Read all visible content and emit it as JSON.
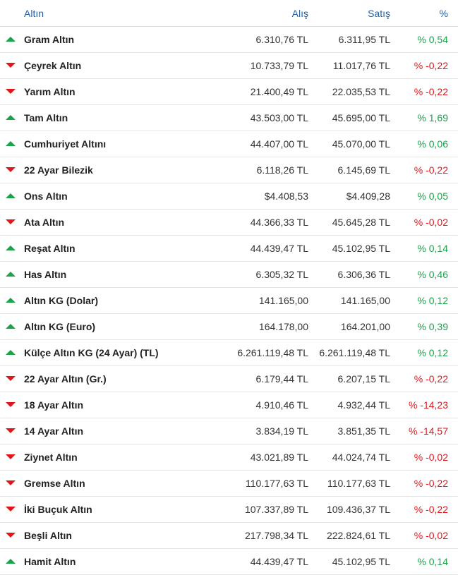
{
  "header": {
    "name": "Altın",
    "bid": "Alış",
    "ask": "Satış",
    "pct": "%"
  },
  "colors": {
    "up": "#1aa34a",
    "down": "#e0161b",
    "header": "#1f5fa8"
  },
  "rows": [
    {
      "name": "Gram Altın",
      "bid": "6.310,76 TL",
      "ask": "6.311,95 TL",
      "pct": "% 0,54",
      "dir": "up"
    },
    {
      "name": "Çeyrek Altın",
      "bid": "10.733,79 TL",
      "ask": "11.017,76 TL",
      "pct": "% -0,22",
      "dir": "down"
    },
    {
      "name": "Yarım Altın",
      "bid": "21.400,49 TL",
      "ask": "22.035,53 TL",
      "pct": "% -0,22",
      "dir": "down"
    },
    {
      "name": "Tam Altın",
      "bid": "43.503,00 TL",
      "ask": "45.695,00 TL",
      "pct": "% 1,69",
      "dir": "up"
    },
    {
      "name": "Cumhuriyet Altını",
      "bid": "44.407,00 TL",
      "ask": "45.070,00 TL",
      "pct": "% 0,06",
      "dir": "up"
    },
    {
      "name": "22 Ayar Bilezik",
      "bid": "6.118,26 TL",
      "ask": "6.145,69 TL",
      "pct": "% -0,22",
      "dir": "down"
    },
    {
      "name": "Ons Altın",
      "bid": "$4.408,53",
      "ask": "$4.409,28",
      "pct": "% 0,05",
      "dir": "up"
    },
    {
      "name": "Ata Altın",
      "bid": "44.366,33 TL",
      "ask": "45.645,28 TL",
      "pct": "% -0,02",
      "dir": "down"
    },
    {
      "name": "Reşat Altın",
      "bid": "44.439,47 TL",
      "ask": "45.102,95 TL",
      "pct": "% 0,14",
      "dir": "up"
    },
    {
      "name": "Has Altın",
      "bid": "6.305,32 TL",
      "ask": "6.306,36 TL",
      "pct": "% 0,46",
      "dir": "up"
    },
    {
      "name": "Altın KG (Dolar)",
      "bid": "141.165,00",
      "ask": "141.165,00",
      "pct": "% 0,12",
      "dir": "up"
    },
    {
      "name": "Altın KG (Euro)",
      "bid": "164.178,00",
      "ask": "164.201,00",
      "pct": "% 0,39",
      "dir": "up"
    },
    {
      "name": "Külçe Altın KG (24 Ayar) (TL)",
      "bid": "6.261.119,48 TL",
      "ask": "6.261.119,48 TL",
      "pct": "% 0,12",
      "dir": "up"
    },
    {
      "name": "22 Ayar Altın (Gr.)",
      "bid": "6.179,44 TL",
      "ask": "6.207,15 TL",
      "pct": "% -0,22",
      "dir": "down"
    },
    {
      "name": "18 Ayar Altın",
      "bid": "4.910,46 TL",
      "ask": "4.932,44 TL",
      "pct": "% -14,23",
      "dir": "down"
    },
    {
      "name": "14 Ayar Altın",
      "bid": "3.834,19 TL",
      "ask": "3.851,35 TL",
      "pct": "% -14,57",
      "dir": "down"
    },
    {
      "name": "Ziynet Altın",
      "bid": "43.021,89 TL",
      "ask": "44.024,74 TL",
      "pct": "% -0,02",
      "dir": "down"
    },
    {
      "name": "Gremse Altın",
      "bid": "110.177,63 TL",
      "ask": "110.177,63 TL",
      "pct": "% -0,22",
      "dir": "down"
    },
    {
      "name": "İki Buçuk Altın",
      "bid": "107.337,89 TL",
      "ask": "109.436,37 TL",
      "pct": "% -0,22",
      "dir": "down"
    },
    {
      "name": "Beşli Altın",
      "bid": "217.798,34 TL",
      "ask": "222.824,61 TL",
      "pct": "% -0,02",
      "dir": "down"
    },
    {
      "name": "Hamit Altın",
      "bid": "44.439,47 TL",
      "ask": "45.102,95 TL",
      "pct": "% 0,14",
      "dir": "up"
    }
  ]
}
